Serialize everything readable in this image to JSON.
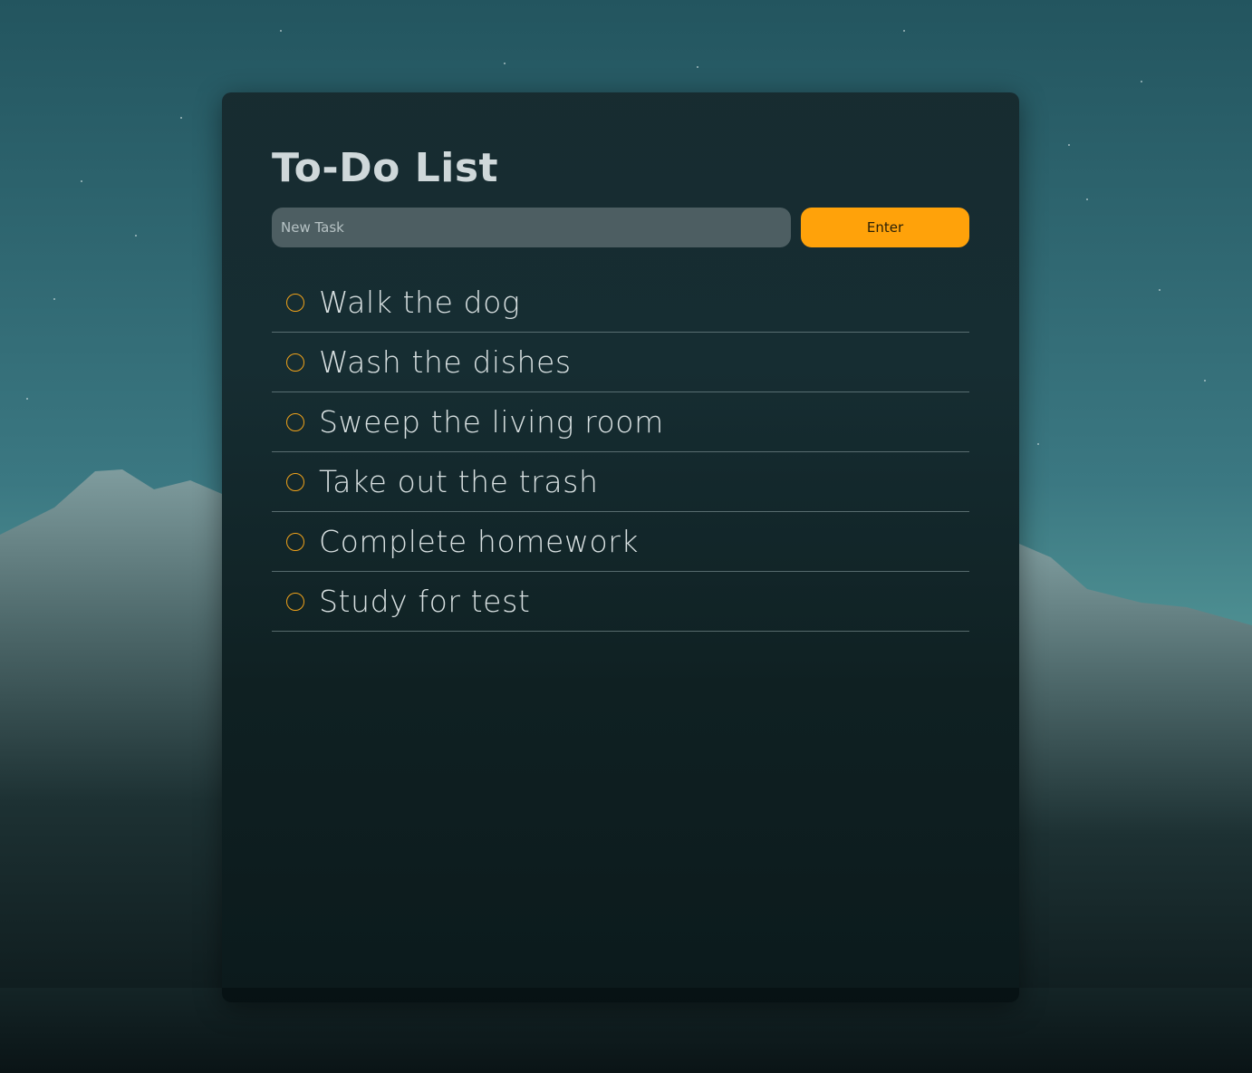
{
  "app": {
    "title": "To-Do List"
  },
  "new_task": {
    "placeholder": "New Task",
    "value": "",
    "enter_label": "Enter"
  },
  "tasks": [
    {
      "label": "Walk the dog",
      "completed": false
    },
    {
      "label": "Wash the dishes",
      "completed": false
    },
    {
      "label": "Sweep the living room",
      "completed": false
    },
    {
      "label": "Take out the trash",
      "completed": false
    },
    {
      "label": "Complete homework",
      "completed": false
    },
    {
      "label": "Study for test",
      "completed": false
    }
  ],
  "colors": {
    "accent": "#ffa20a",
    "checkbox_border": "#f0a21a",
    "input_bg": "#4d5e62",
    "panel_bg": "#16282c",
    "text": "#d8e0e1"
  },
  "icons": {
    "checkbox": "circle-checkbox-icon"
  }
}
